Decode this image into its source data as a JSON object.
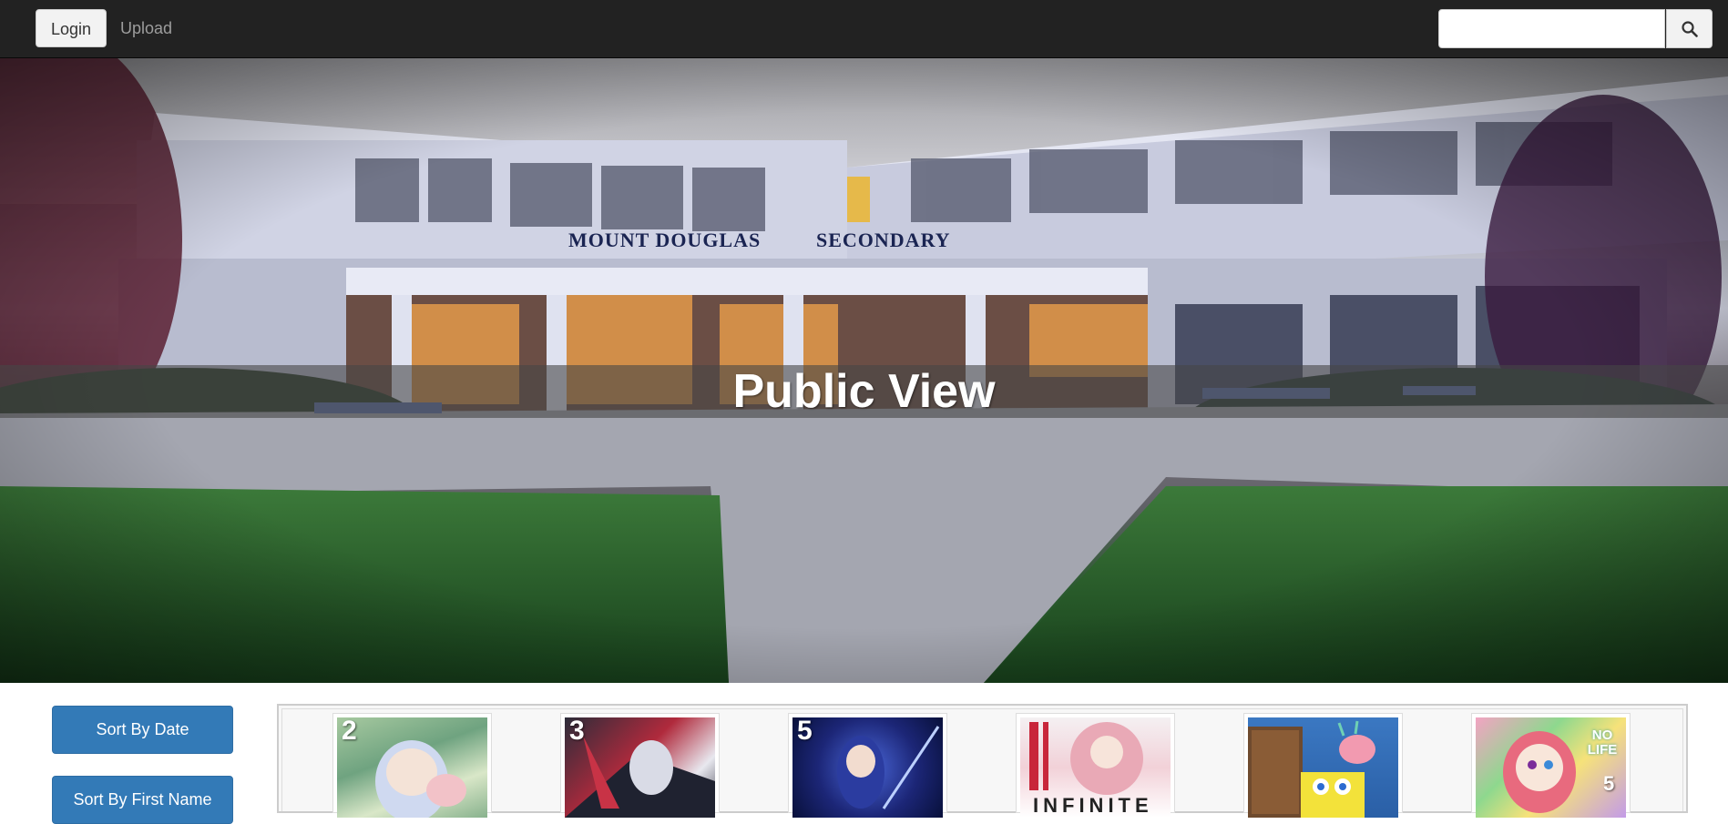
{
  "navbar": {
    "login_label": "Login",
    "upload_label": "Upload",
    "search_placeholder": ""
  },
  "hero": {
    "title": "Public View",
    "sign_left": "MOUNT DOUGLAS",
    "sign_right": "SECONDARY"
  },
  "sidebar": {
    "sort_date_label": "Sort By Date",
    "sort_first_name_label": "Sort By First Name"
  },
  "gallery": {
    "items": [
      {
        "volume": "2",
        "icon": "manga-cover-green"
      },
      {
        "volume": "3",
        "icon": "manga-cover-mecha"
      },
      {
        "volume": "5",
        "icon": "manga-cover-blue"
      },
      {
        "volume": "",
        "title_text": "INFINITE",
        "icon": "manga-cover-infinite"
      },
      {
        "volume": "",
        "icon": "spongebob-cover"
      },
      {
        "volume": "5",
        "title_text": "NO LIFE",
        "icon": "manga-cover-no-game-no-life"
      }
    ]
  },
  "colors": {
    "navbar_bg": "#222222",
    "primary_button": "#337ab7",
    "hero_band": "rgba(70,70,70,0.6)"
  }
}
